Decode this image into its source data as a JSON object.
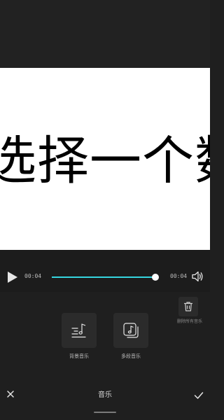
{
  "preview": {
    "overlay_text": "选择一个数"
  },
  "player": {
    "current_time": "00:04",
    "total_time": "00:04",
    "progress": 1.0,
    "play_icon": "play-icon",
    "volume_icon": "volume-icon"
  },
  "tools": {
    "delete_label": "删除所有音乐",
    "delete_icon": "trash-icon",
    "items": [
      {
        "label": "背景音乐",
        "icon": "background-music-icon"
      },
      {
        "label": "多段音乐",
        "icon": "multi-segment-music-icon"
      }
    ]
  },
  "bottom_bar": {
    "title": "音乐",
    "close_icon": "close-icon",
    "confirm_icon": "check-icon"
  },
  "colors": {
    "accent": "#36d6e0",
    "background": "#1f1f1f",
    "tile": "#2b2b2b"
  }
}
